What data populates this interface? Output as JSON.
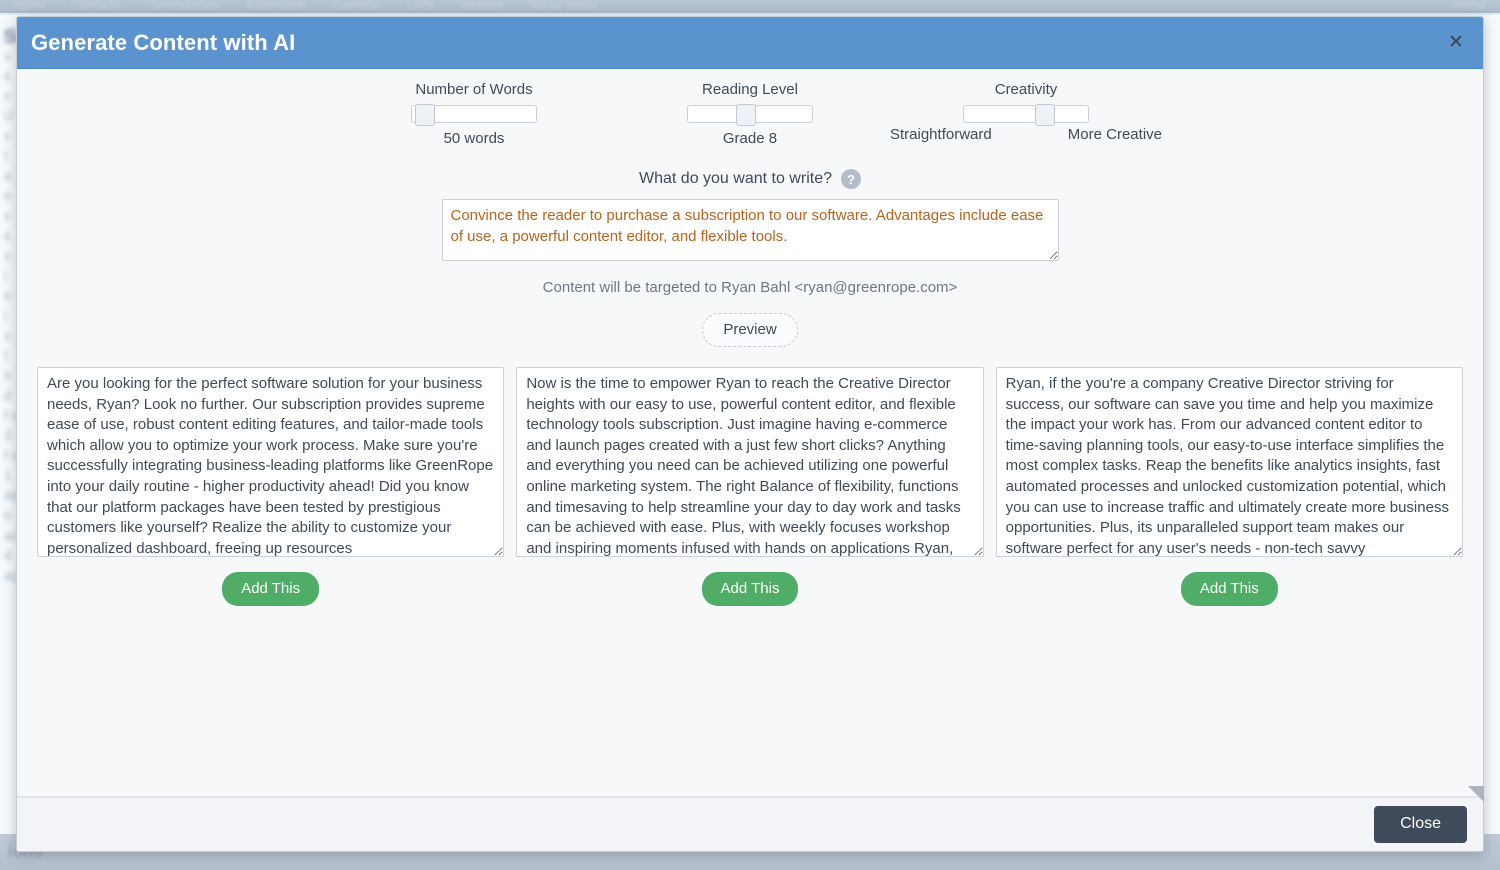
{
  "background": {
    "top_nav_items": [
      "Home",
      "Contacts",
      "Communicate",
      "Automation",
      "Calendar",
      "CRM",
      "Website",
      "Social Media"
    ],
    "top_nav_right": "Profile",
    "heading": "S",
    "text_lines": [
      "Not",
      "u",
      "s",
      "c",
      "U",
      "v",
      "t",
      "a",
      "e",
      "v",
      "s",
      "s",
      "i",
      "e",
      "i",
      "s",
      "t",
      "h",
      "d",
      "f ol",
      "3",
      "f ol",
      "1",
      "Abo",
      "h",
      "acc",
      "4",
      "age"
    ],
    "bottom_label": "ions"
  },
  "modal": {
    "title": "Generate Content with AI",
    "close_x_icon": "close-icon",
    "sliders": [
      {
        "label": "Number of Words",
        "value_text": "50 words",
        "thumb_percent": 3,
        "end_labels": null
      },
      {
        "label": "Reading Level",
        "value_text": "Grade  8",
        "thumb_percent": 45,
        "end_labels": null
      },
      {
        "label": "Creativity",
        "value_text": "",
        "thumb_percent": 67,
        "end_labels": [
          "Straightforward",
          "More Creative"
        ]
      }
    ],
    "prompt": {
      "question_label": "What do you want to write?",
      "help_icon": "help-icon",
      "help_glyph": "?",
      "value": "Convince the reader to purchase a subscription to our software. Advantages include ease of use, a powerful content editor, and flexible tools.",
      "placeholder": "What do you want to write?",
      "target_note": "Content will be targeted to Ryan Bahl <ryan@greenrope.com>",
      "preview_label": "Preview"
    },
    "results": [
      {
        "text": "Are you looking for the perfect software solution for your business needs, Ryan? Look no further. Our subscription provides supreme ease of use, robust content editing features, and tailor-made tools which allow you to optimize your work process. Make sure you're successfully integrating business-leading platforms like GreenRope into your daily routine - higher productivity ahead! Did you know that our platform packages have been tested by prestigious customers like yourself? Realize the ability to customize your personalized dashboard, freeing up resources",
        "add_label": "Add This"
      },
      {
        "text": "Now is the time to empower Ryan to reach the Creative Director heights with our easy to use, powerful content editor, and flexible technology tools subscription. Just imagine having e-commerce and launch pages created with a just few short clicks? Anything and everything you need can be achieved utilizing one powerful online marketing system. The right Balance of flexibility, functions and timesaving to help streamline your day to day work and tasks can be achieved with ease. Plus, with weekly focuses workshop and inspiring moments infused with hands on applications Ryan,",
        "add_label": "Add This"
      },
      {
        "text": "Ryan, if the you're a company Creative Director striving for success, our software can save you time and help you maximize the impact your work has. From our advanced content editor to time-saving planning tools, our easy-to-use interface simplifies the most complex tasks. Reap the benefits like analytics insights, fast automated processes and unlocked customization potential, which you can use to increase traffic and ultimately create more business opportunities. Plus, its unparalleled support team makes our software perfect for any user's needs - non-tech savvy",
        "add_label": "Add This"
      }
    ],
    "footer": {
      "close_label": "Close"
    }
  },
  "colors": {
    "header_blue": "#5b93ce",
    "add_button_green": "#4fad68",
    "close_button_dark": "#3f4a5a",
    "prompt_text_orange": "#b5651d"
  }
}
